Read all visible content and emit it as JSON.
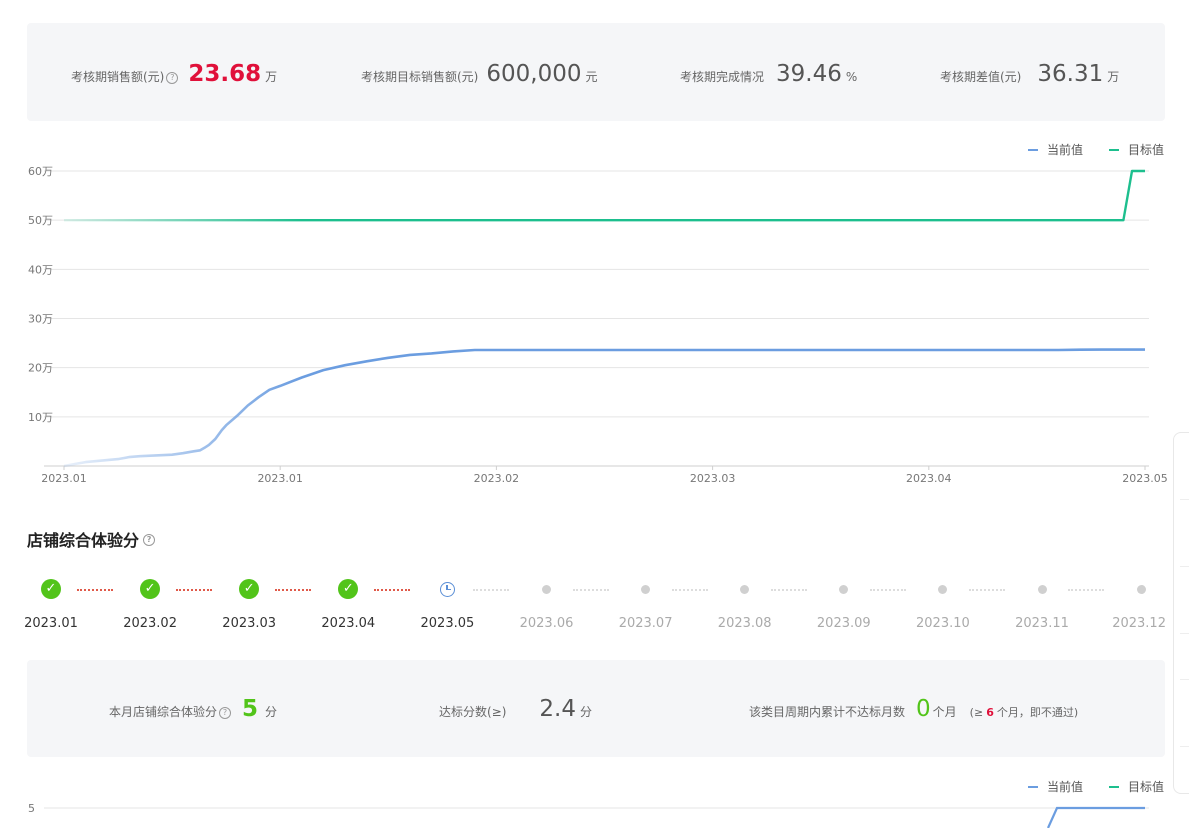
{
  "period_stats": {
    "sales_label": "考核期销售额(元)",
    "sales_value": "23.68",
    "sales_unit": "万",
    "target_label": "考核期目标销售额(元)",
    "target_value": "600,000",
    "target_unit": "元",
    "completion_label": "考核期完成情况",
    "completion_value": "39.46",
    "completion_unit": "%",
    "diff_label": "考核期差值(元)",
    "diff_value": "36.31",
    "diff_unit": "万"
  },
  "legend": {
    "current": "当前值",
    "target": "目标值"
  },
  "colors": {
    "current": "#6b9de0",
    "target": "#1dbf8e",
    "accent_red": "#e0103a",
    "green": "#52c41a"
  },
  "chart_data": [
    {
      "type": "line",
      "ylim": [
        0,
        60
      ],
      "y_ticks": [
        "10万",
        "20万",
        "30万",
        "40万",
        "50万",
        "60万"
      ],
      "y_tick_values": [
        10,
        20,
        30,
        40,
        50,
        60
      ],
      "x_ticks": [
        "2023.01",
        "2023.01",
        "2023.02",
        "2023.03",
        "2023.04",
        "2023.05"
      ],
      "series": [
        {
          "name": "当前值",
          "x": [
            0,
            5,
            10,
            15,
            20,
            25,
            30,
            35,
            40,
            45,
            50,
            55,
            60,
            63,
            65,
            67,
            70,
            73,
            75,
            80,
            85,
            90,
            95,
            100,
            110,
            120,
            130,
            140,
            150,
            160,
            170,
            180,
            190,
            200,
            210,
            220,
            230,
            240,
            250,
            260,
            270,
            280,
            290,
            300,
            310,
            320,
            330,
            340,
            350,
            360,
            370,
            380,
            390,
            400,
            410,
            420,
            430,
            440,
            450,
            460,
            470,
            480,
            490,
            500
          ],
          "values": [
            0,
            0.4,
            0.8,
            1.0,
            1.2,
            1.4,
            1.8,
            2.0,
            2.1,
            2.2,
            2.3,
            2.6,
            3.0,
            3.2,
            3.7,
            4.3,
            5.5,
            7.3,
            8.3,
            10.2,
            12.3,
            14.0,
            15.5,
            16.3,
            18.0,
            19.5,
            20.5,
            21.3,
            22.0,
            22.6,
            22.9,
            23.3,
            23.6,
            23.6,
            23.6,
            23.6,
            23.6,
            23.6,
            23.6,
            23.6,
            23.6,
            23.6,
            23.6,
            23.6,
            23.6,
            23.6,
            23.6,
            23.6,
            23.6,
            23.6,
            23.6,
            23.6,
            23.6,
            23.6,
            23.6,
            23.6,
            23.6,
            23.6,
            23.6,
            23.6,
            23.65,
            23.68,
            23.68,
            23.68
          ]
        },
        {
          "name": "目标值",
          "x": [
            0,
            490,
            494,
            500
          ],
          "values": [
            50,
            50,
            60,
            60
          ]
        }
      ]
    },
    {
      "type": "line",
      "y_ticks": [
        "5"
      ],
      "series": [
        {
          "name": "当前值",
          "values": []
        },
        {
          "name": "目标值",
          "values": [
            5,
            5
          ]
        }
      ]
    }
  ],
  "store_score_section": {
    "title": "店铺综合体验分",
    "months": [
      {
        "label": "2023.01",
        "status": "passed"
      },
      {
        "label": "2023.02",
        "status": "passed"
      },
      {
        "label": "2023.03",
        "status": "passed"
      },
      {
        "label": "2023.04",
        "status": "passed"
      },
      {
        "label": "2023.05",
        "status": "current"
      },
      {
        "label": "2023.06",
        "status": "future"
      },
      {
        "label": "2023.07",
        "status": "future"
      },
      {
        "label": "2023.08",
        "status": "future"
      },
      {
        "label": "2023.09",
        "status": "future"
      },
      {
        "label": "2023.10",
        "status": "future"
      },
      {
        "label": "2023.11",
        "status": "future"
      },
      {
        "label": "2023.12",
        "status": "future"
      }
    ]
  },
  "score_stats": {
    "month_score_label": "本月店铺综合体验分",
    "month_score_value": "5",
    "month_score_unit": "分",
    "standard_label": "达标分数(≥)",
    "standard_value": "2.4",
    "standard_unit": "分",
    "fail_label": "该类目周期内累计不达标月数",
    "fail_value": "0",
    "fail_unit": "个月",
    "fail_note_prefix": "(≥",
    "fail_note_num": "6",
    "fail_note_suffix": "个月，即不通过)"
  },
  "chart2_ytick": "5"
}
